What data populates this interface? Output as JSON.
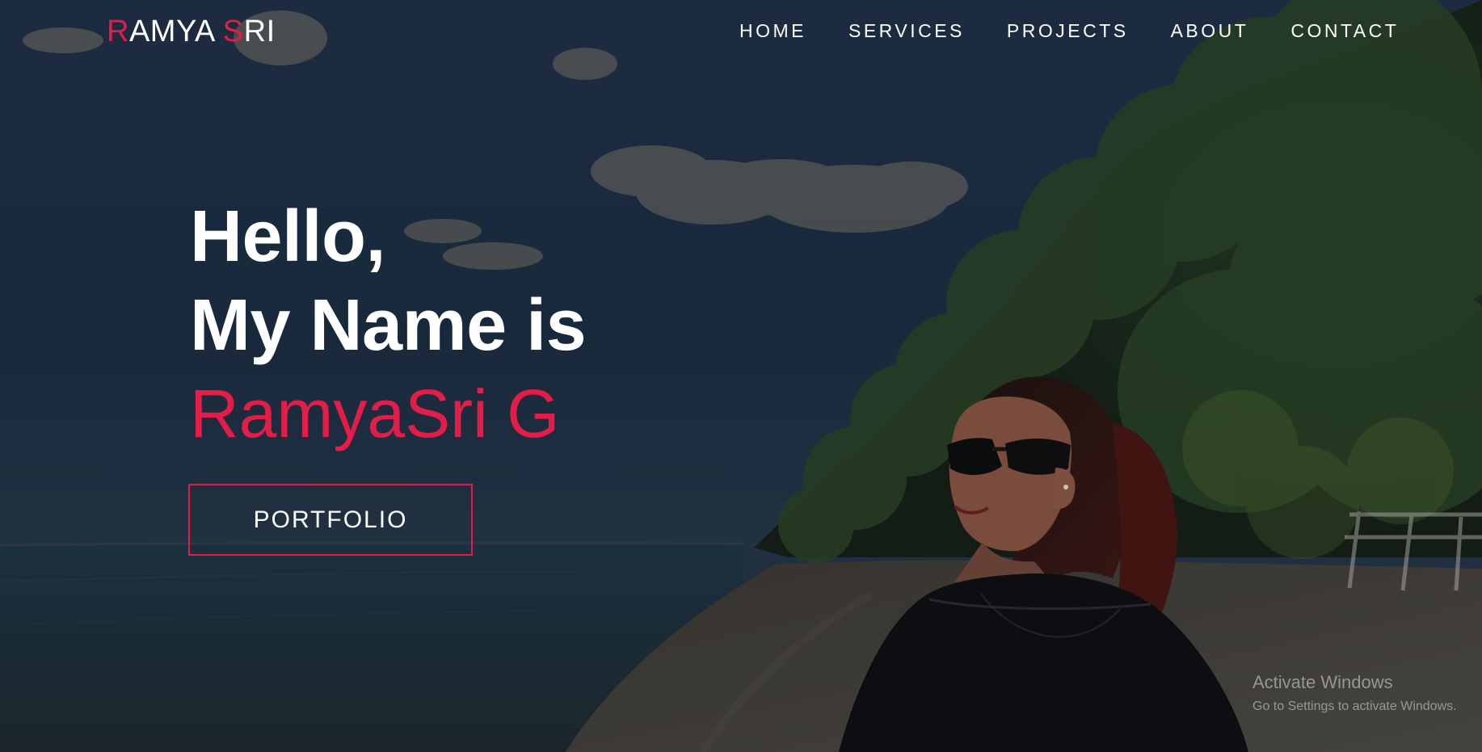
{
  "brand": {
    "logo_first": "R",
    "logo_mid": "AMYA ",
    "logo_s": "S",
    "logo_rest": "RI",
    "accent_color": "#e11d48"
  },
  "nav": {
    "items": [
      "HOME",
      "SERVICES",
      "PROJECTS",
      "ABOUT",
      "CONTACT"
    ]
  },
  "hero": {
    "line1": "Hello,",
    "line2": "My Name is",
    "name": "RamyaSri G",
    "button": "PORTFOLIO"
  },
  "watermark": {
    "title": "Activate Windows",
    "subtitle": "Go to Settings to activate Windows."
  }
}
